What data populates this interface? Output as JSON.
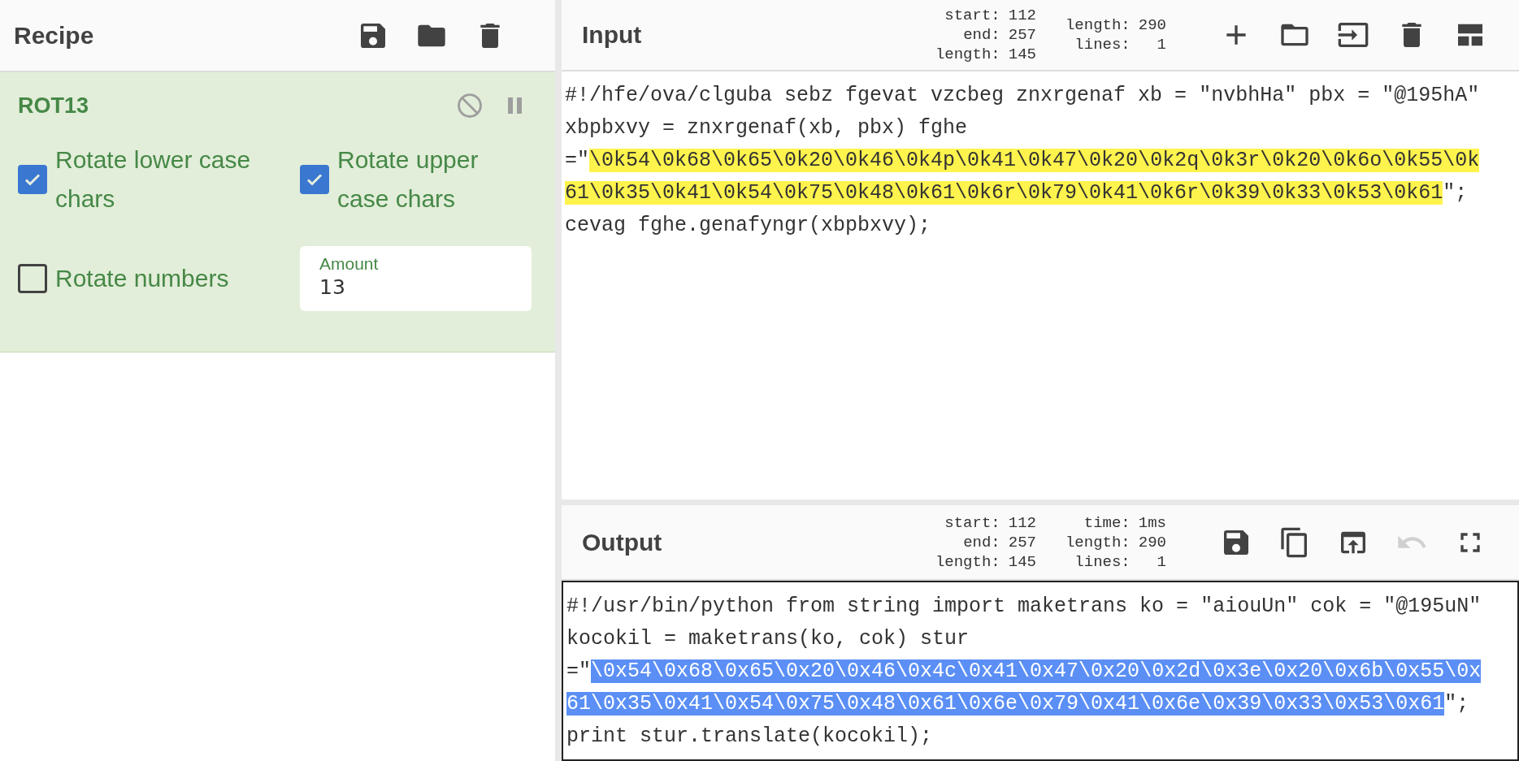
{
  "recipe": {
    "title": "Recipe",
    "operation": {
      "name": "ROT13",
      "options": [
        {
          "kind": "checkbox",
          "label": "Rotate lower case chars",
          "checked": true
        },
        {
          "kind": "checkbox",
          "label": "Rotate upper case chars",
          "checked": true
        },
        {
          "kind": "checkbox",
          "label": "Rotate numbers",
          "checked": false
        },
        {
          "kind": "number",
          "label": "Amount",
          "value": "13"
        }
      ]
    }
  },
  "input": {
    "kind": "input",
    "title": "Input",
    "stat_columns": [
      [
        {
          "label": "start:",
          "value": "112"
        },
        {
          "label": "end:",
          "value": "257"
        },
        {
          "label": "length:",
          "value": "145"
        }
      ],
      [
        {
          "label": "length:",
          "value": "290"
        },
        {
          "label": "lines:",
          "value": "1"
        }
      ]
    ],
    "text_before": "#!/hfe/ova/clguba sebz fgevat vzcbeg znxrgenaf xb = \"nvbhHa\" pbx = \"@195hA\" xbpbxvy = znxrgenaf(xb, pbx) fghe =\"",
    "selection_lines": [
      "\\0k54\\0k68\\0k65\\0k20\\0k46\\0k4p\\0k41\\0k47\\0k20\\0k2q\\0k3r\\0k20\\0k6o\\0k55\\0k",
      "61\\0k35\\0k41\\0k54\\0k75\\0k48\\0k61\\0k6r\\0k79\\0k41\\0k6r\\0k39\\0k33\\0k53\\0k61"
    ],
    "text_after": "\"; cevag fghe.genafyngr(xbpbxvy);"
  },
  "output": {
    "kind": "output",
    "title": "Output",
    "undo_disabled": true,
    "stat_columns": [
      [
        {
          "label": "start:",
          "value": "112"
        },
        {
          "label": "end:",
          "value": "257"
        },
        {
          "label": "length:",
          "value": "145"
        }
      ],
      [
        {
          "label": "time:",
          "value": "1ms"
        },
        {
          "label": "length:",
          "value": "290"
        },
        {
          "label": "lines:",
          "value": "1"
        }
      ]
    ],
    "text_before": "#!/usr/bin/python from string import maketrans ko = \"aiouUn\" cok = \"@195uN\" kocokil = maketrans(ko, cok) stur =\"",
    "selection_lines": [
      "\\0x54\\0x68\\0x65\\0x20\\0x46\\0x4c\\0x41\\0x47\\0x20\\0x2d\\0x3e\\0x20\\0x6b\\0x55\\0x",
      "61\\0x35\\0x41\\0x54\\0x75\\0x48\\0x61\\0x6e\\0x79\\0x41\\0x6e\\0x39\\0x33\\0x53\\0x61"
    ],
    "text_after": "\"; print stur.translate(kocokil);"
  }
}
